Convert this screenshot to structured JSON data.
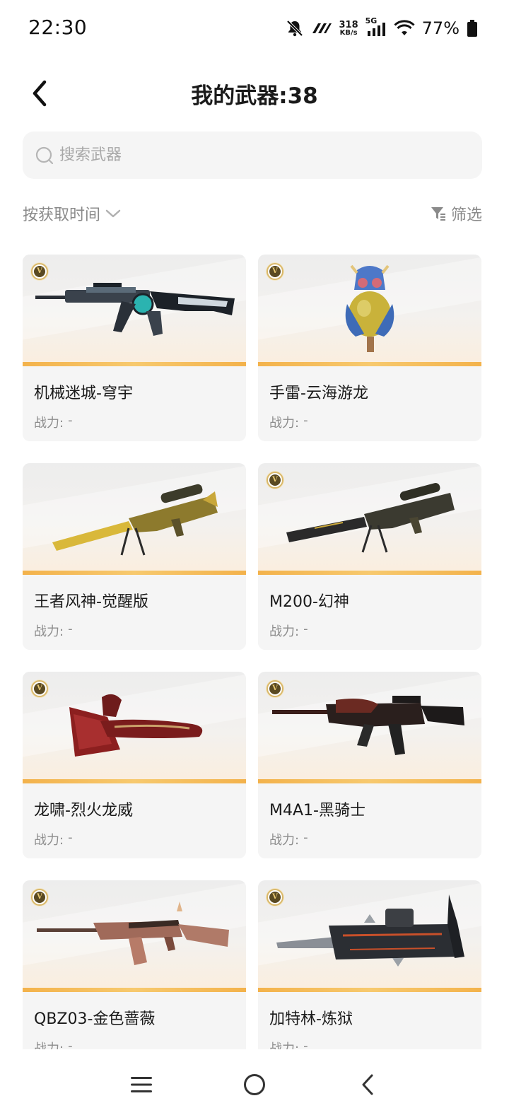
{
  "status_bar": {
    "time": "22:30",
    "net_speed_value": "318",
    "net_speed_unit": "KB/s",
    "network": "5G",
    "battery": "77%",
    "icons": [
      "mute-bell-icon",
      "app-notification-icon",
      "signal-icon",
      "wifi-icon",
      "battery-icon"
    ]
  },
  "header": {
    "title": "我的武器:38"
  },
  "search": {
    "placeholder": "搜索武器"
  },
  "toolbar": {
    "sort_label": "按获取时间",
    "filter_label": "筛选"
  },
  "weapons": [
    {
      "name": "机械迷城-穹宇",
      "power_label": "战力:",
      "power_value": "-",
      "badge": "V"
    },
    {
      "name": "手雷-云海游龙",
      "power_label": "战力:",
      "power_value": "-",
      "badge": "V"
    },
    {
      "name": "王者风神-觉醒版",
      "power_label": "战力:",
      "power_value": "-",
      "badge": ""
    },
    {
      "name": "M200-幻神",
      "power_label": "战力:",
      "power_value": "-",
      "badge": "V"
    },
    {
      "name": "龙啸-烈火龙威",
      "power_label": "战力:",
      "power_value": "-",
      "badge": "V"
    },
    {
      "name": "M4A1-黑骑士",
      "power_label": "战力:",
      "power_value": "-",
      "badge": "V"
    },
    {
      "name": "QBZ03-金色蔷薇",
      "power_label": "战力:",
      "power_value": "-",
      "badge": "V"
    },
    {
      "name": "加特林-炼狱",
      "power_label": "战力:",
      "power_value": "-",
      "badge": "V"
    }
  ],
  "colors": {
    "accent_orange": "#f3b24b",
    "card_bg": "#f5f5f5",
    "muted_text": "#8a8a8a"
  }
}
